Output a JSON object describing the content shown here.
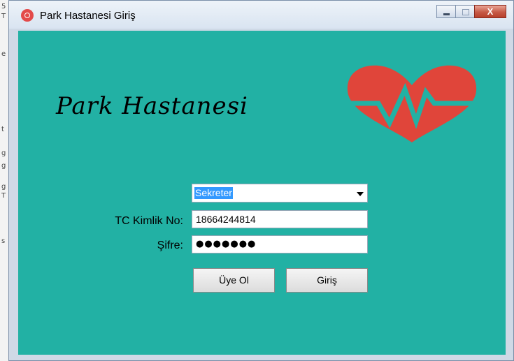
{
  "window": {
    "title": "Park Hastanesi Giriş",
    "close_glyph": "X"
  },
  "branding": {
    "logo_text": "Park Hastanesi",
    "heart_icon": "heartbeat-icon",
    "heart_color": "#e0453a"
  },
  "form": {
    "role_select": {
      "selected": "Sekreter"
    },
    "tc_label": "TC Kimlik No:",
    "tc_value": "18664244814",
    "password_label": "Şifre:",
    "password_masked": "●●●●●●●"
  },
  "buttons": {
    "register_label": "Üye Ol",
    "login_label": "Giriş"
  },
  "colors": {
    "client_bg": "#22b1a4",
    "selection": "#3399ff"
  }
}
